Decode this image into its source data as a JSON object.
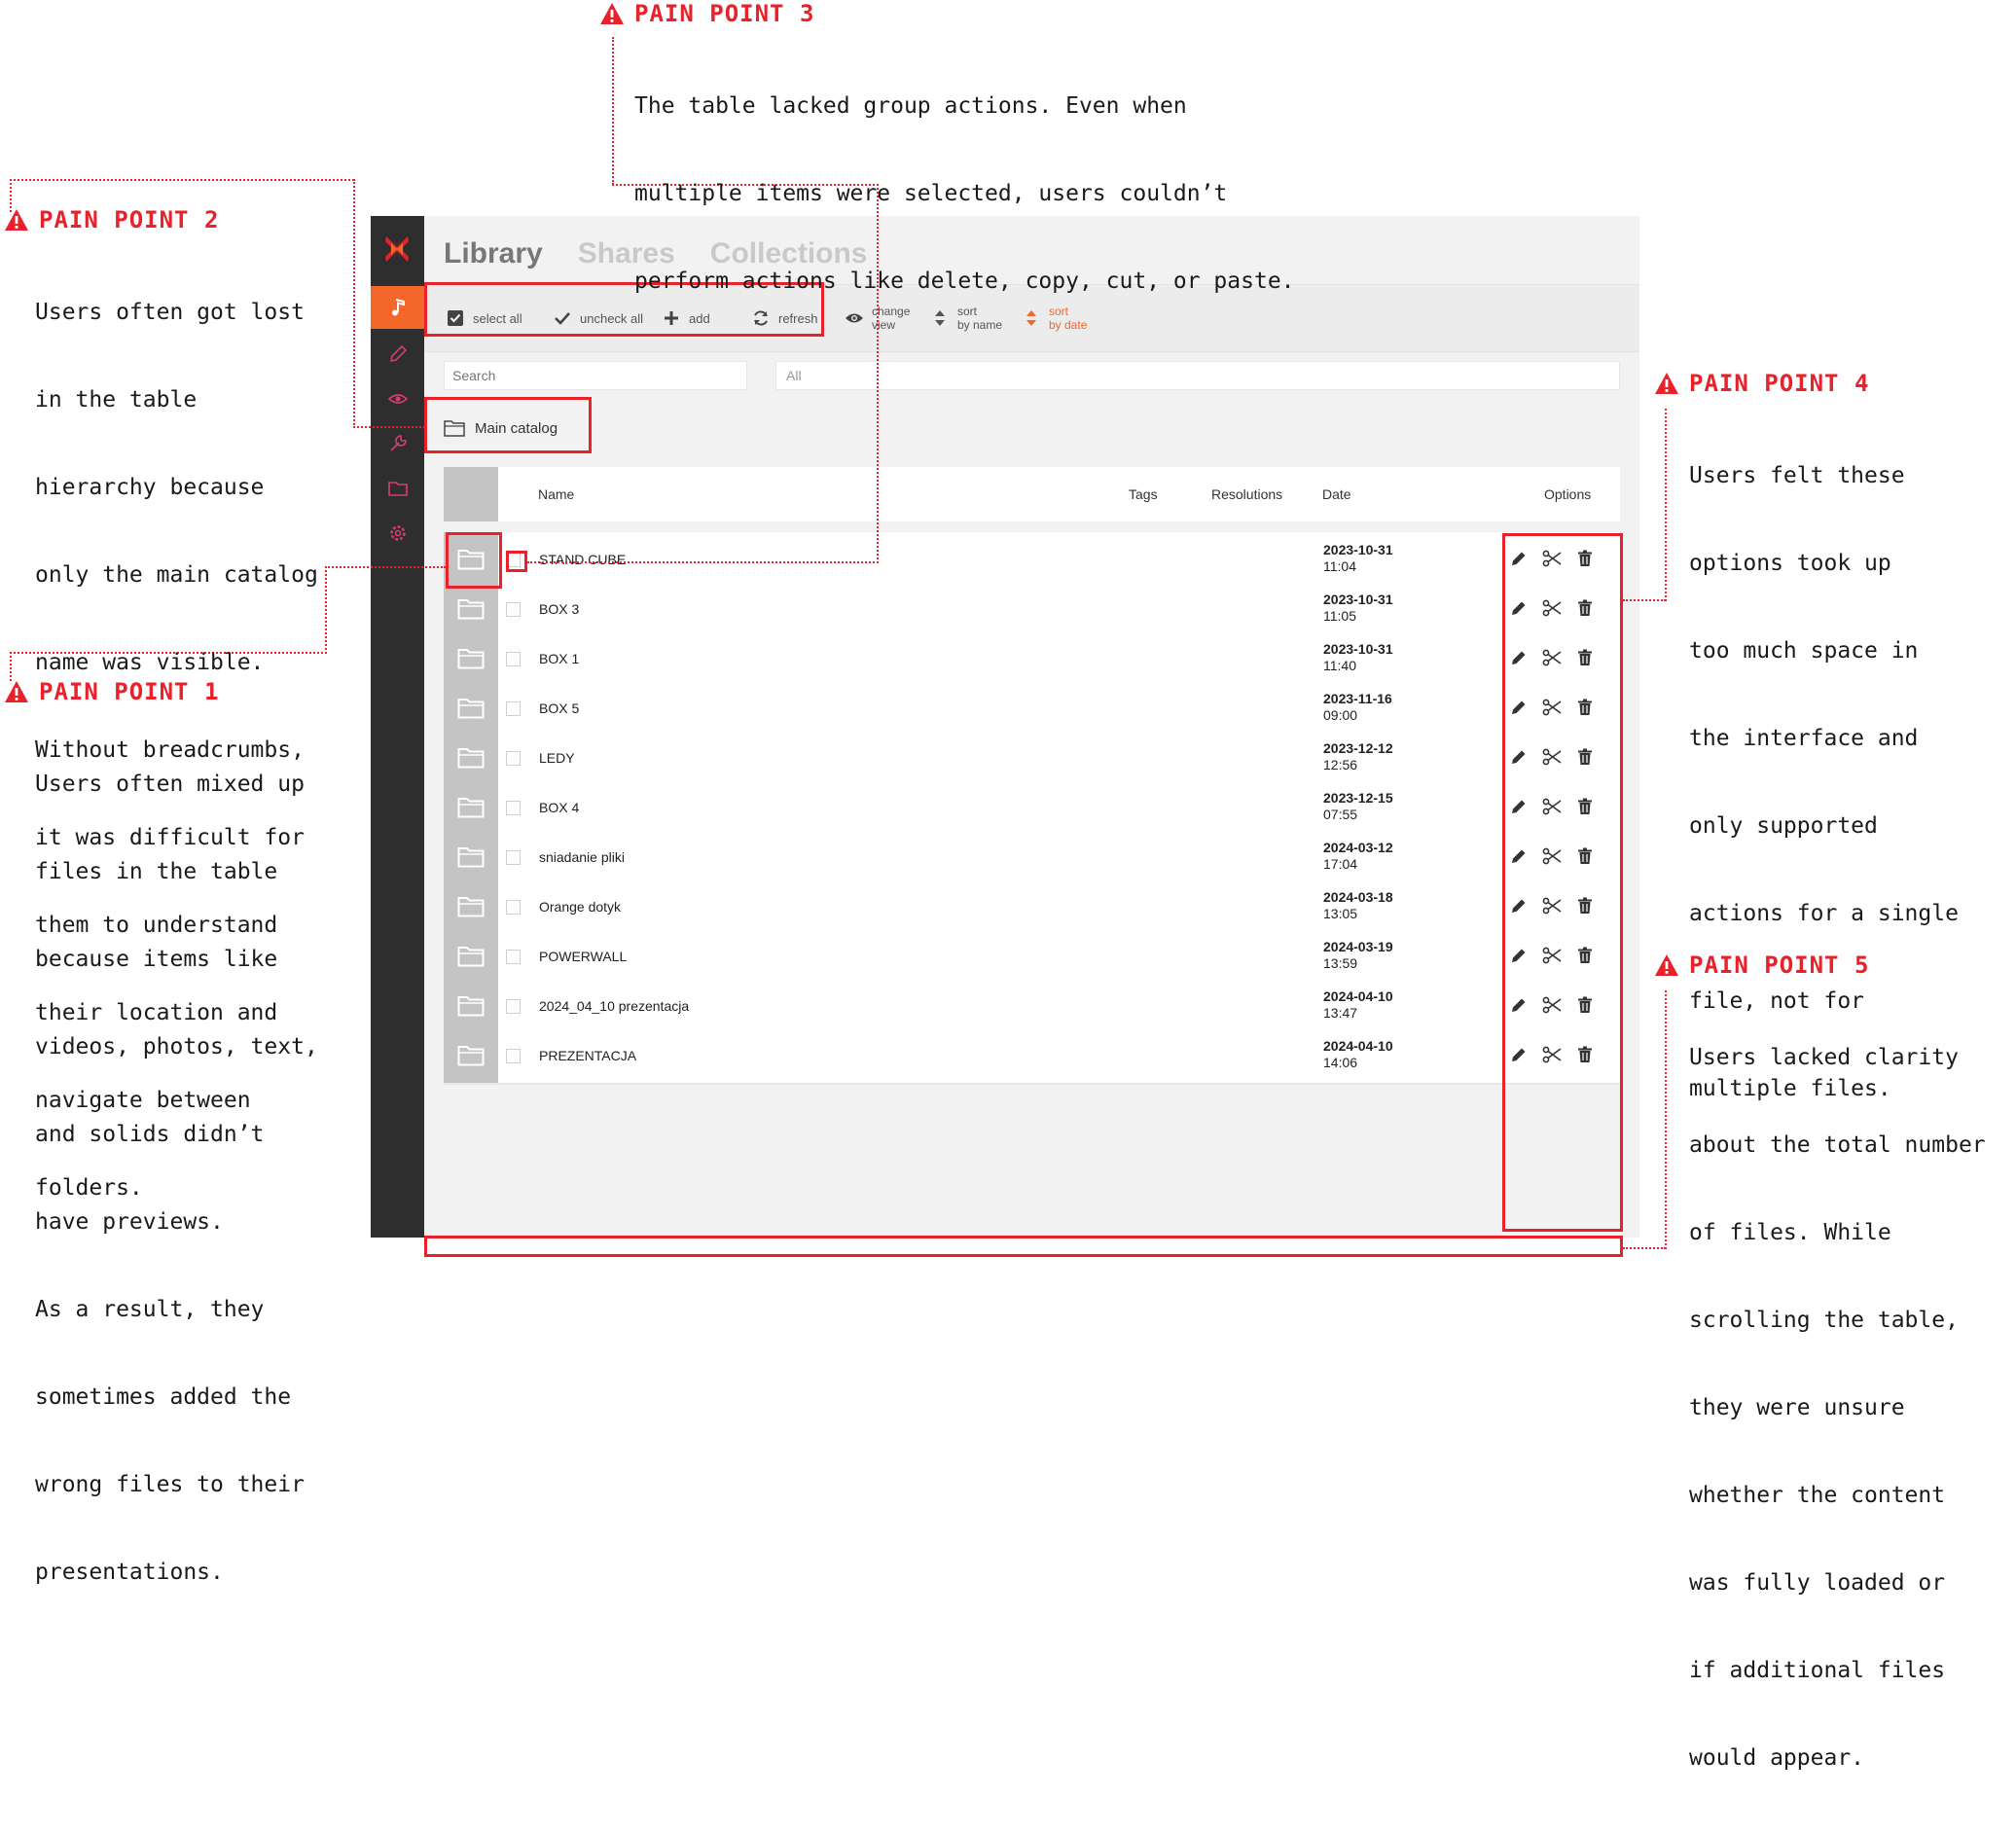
{
  "colors": {
    "accent": "#f4662a",
    "annotation_red": "#e8212a",
    "sidebar_bg": "#2e2e2e"
  },
  "app": {
    "tabs": [
      {
        "label": "Library",
        "active": true
      },
      {
        "label": "Shares",
        "active": false
      },
      {
        "label": "Collections",
        "active": false
      }
    ],
    "sidebar_icons": [
      "logo-icon",
      "music-icon",
      "pencil-icon",
      "eye-icon",
      "wrench-icon",
      "folder-icon",
      "gear-icon"
    ],
    "toolbar": {
      "select_all": "select all",
      "uncheck_all": "uncheck all",
      "add": "add",
      "refresh": "refresh",
      "change_view": [
        "change",
        "view"
      ],
      "sort_name": [
        "sort",
        "by name"
      ],
      "sort_date": [
        "sort",
        "by date"
      ]
    },
    "search": {
      "placeholder": "Search"
    },
    "filter": {
      "value": "All"
    },
    "catalog": "Main catalog",
    "columns": {
      "name": "Name",
      "tags": "Tags",
      "resolutions": "Resolutions",
      "date": "Date",
      "options": "Options"
    },
    "rows": [
      {
        "name": "STAND CUBE",
        "date": "2023-10-31",
        "time": "11:04"
      },
      {
        "name": "BOX 3",
        "date": "2023-10-31",
        "time": "11:05"
      },
      {
        "name": "BOX 1",
        "date": "2023-10-31",
        "time": "11:40"
      },
      {
        "name": "BOX 5",
        "date": "2023-11-16",
        "time": "09:00"
      },
      {
        "name": "LEDY",
        "date": "2023-12-12",
        "time": "12:56"
      },
      {
        "name": "BOX 4",
        "date": "2023-12-15",
        "time": "07:55"
      },
      {
        "name": "sniadanie pliki",
        "date": "2024-03-12",
        "time": "17:04"
      },
      {
        "name": "Orange dotyk",
        "date": "2024-03-18",
        "time": "13:05"
      },
      {
        "name": "POWERWALL",
        "date": "2024-03-19",
        "time": "13:59"
      },
      {
        "name": "2024_04_10 prezentacja",
        "date": "2024-04-10",
        "time": "13:47"
      },
      {
        "name": "PREZENTACJA",
        "date": "2024-04-10",
        "time": "14:06"
      }
    ]
  },
  "pain_points": {
    "p1": {
      "title": "PAIN POINT 1",
      "lines": [
        "Users often mixed up",
        "files in the table",
        "because items like",
        "videos, photos, text,",
        "and solids didn’t",
        "have previews.",
        "As a result, they",
        "sometimes added the",
        "wrong files to their",
        "presentations."
      ]
    },
    "p2": {
      "title": "PAIN POINT 2",
      "lines": [
        "Users often got lost",
        "in the table",
        "hierarchy because",
        "only the main catalog",
        "name was visible.",
        "Without breadcrumbs,",
        "it was difficult for",
        "them to understand",
        "their location and",
        "navigate between",
        "folders."
      ]
    },
    "p3": {
      "title": "PAIN POINT 3",
      "lines": [
        "The table lacked group actions. Even when",
        "multiple items were selected, users couldn’t",
        "perform actions like delete, copy, cut, or paste."
      ]
    },
    "p4": {
      "title": "PAIN POINT 4",
      "lines": [
        "Users felt these",
        "options took up",
        "too much space in",
        "the interface and",
        "only supported",
        "actions for a single",
        "file, not for",
        "multiple files."
      ]
    },
    "p5": {
      "title": "PAIN POINT 5",
      "lines": [
        "Users lacked clarity",
        "about the total number",
        "of files. While",
        "scrolling the table,",
        "they were unsure",
        "whether the content",
        "was fully loaded or",
        "if additional files",
        "would appear."
      ]
    }
  }
}
